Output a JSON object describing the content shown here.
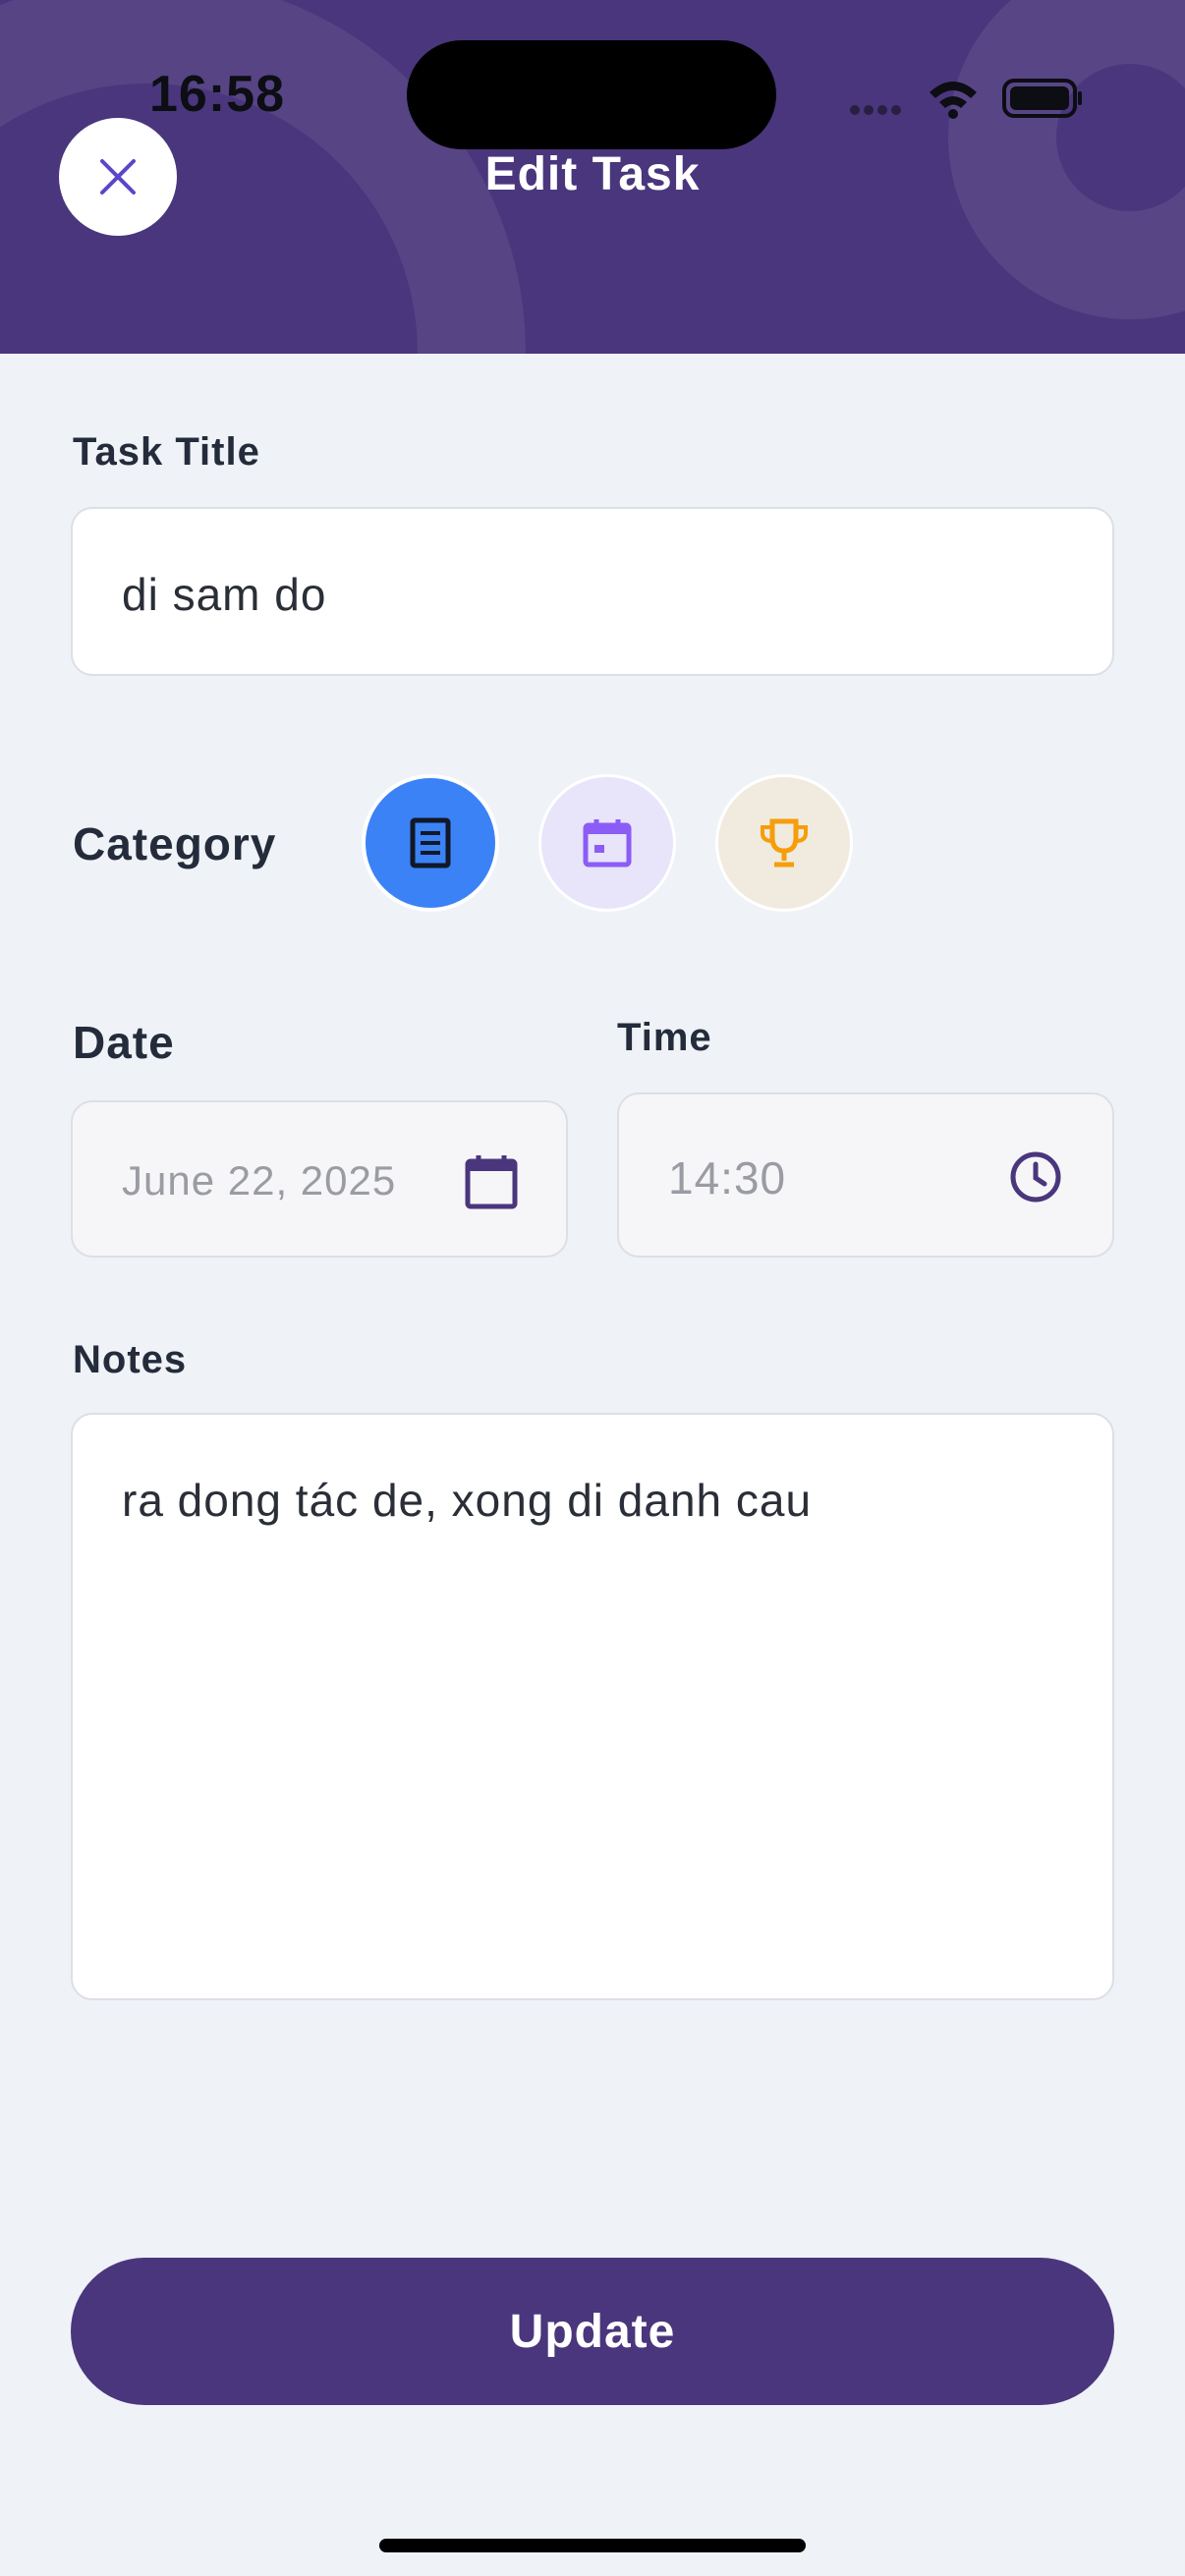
{
  "status_bar": {
    "time": "16:58"
  },
  "header": {
    "title": "Edit Task",
    "close_icon": "close-icon"
  },
  "form": {
    "task_title": {
      "label": "Task Title",
      "value": "di sam do"
    },
    "category": {
      "label": "Category",
      "options": [
        {
          "icon": "document-icon",
          "color": "#3b82f6",
          "selected": true
        },
        {
          "icon": "calendar-icon",
          "color": "#8b5cf6",
          "selected": false
        },
        {
          "icon": "trophy-icon",
          "color": "#f59e0b",
          "selected": false
        }
      ]
    },
    "date": {
      "label": "Date",
      "value": "June 22, 2025",
      "icon": "calendar-icon"
    },
    "time": {
      "label": "Time",
      "value": "14:30",
      "icon": "clock-icon"
    },
    "notes": {
      "label": "Notes",
      "value": "ra dong tác de, xong di danh cau"
    }
  },
  "actions": {
    "update_label": "Update"
  },
  "colors": {
    "primary": "#4a367c",
    "background": "#eff2f7"
  }
}
